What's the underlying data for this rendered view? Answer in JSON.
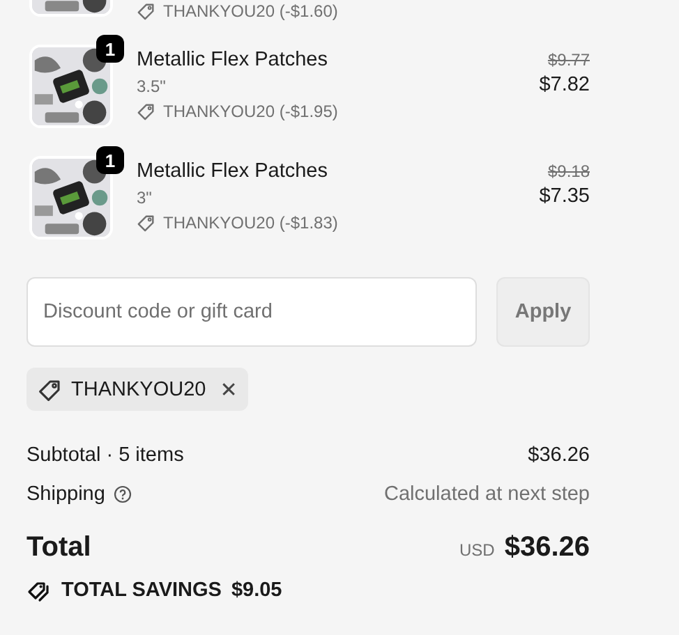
{
  "items": [
    {
      "discount": "THANKYOU20 (-$1.60)"
    },
    {
      "title": "Metallic Flex Patches",
      "variant": "3.5\"",
      "quantity": "1",
      "discount": "THANKYOU20 (-$1.95)",
      "original_price": "$9.77",
      "price": "$7.82"
    },
    {
      "title": "Metallic Flex Patches",
      "variant": "3\"",
      "quantity": "1",
      "discount": "THANKYOU20 (-$1.83)",
      "original_price": "$9.18",
      "price": "$7.35"
    }
  ],
  "discount_field": {
    "placeholder": "Discount code or gift card",
    "button": "Apply",
    "button_disabled": true
  },
  "applied_codes": [
    {
      "code": "THANKYOU20",
      "remove": "✕"
    }
  ],
  "summary": [
    {
      "kind": "subtotal",
      "label": "Subtotal · 5 items",
      "value": "$36.26"
    },
    {
      "kind": "shipping",
      "label": "Shipping",
      "value": "Calculated at next step"
    }
  ],
  "total": {
    "label": "Total",
    "currency": "USD",
    "value": "$36.26"
  },
  "savings": {
    "label": "TOTAL SAVINGS",
    "value": "$9.05"
  }
}
